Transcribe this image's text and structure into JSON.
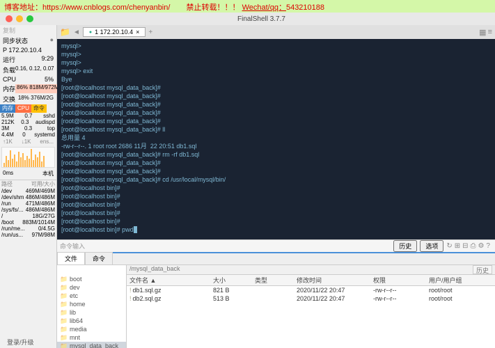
{
  "banner": {
    "prefix": "博客地址：",
    "url": "https://www.cnblogs.com/chenyanbin/",
    "warn": "禁止转载！！！",
    "contact_label": "Wechat/qq：",
    "contact": "543210188"
  },
  "titlebar": {
    "title": "FinalShell 3.7.7"
  },
  "sidebar": {
    "sync_label": "同步状态",
    "sync_icon": "●",
    "ip": "P 172.20.10.4",
    "runtime_label": "运行",
    "runtime": "9:29",
    "load_label": "负载",
    "load": "0.16, 0.12, 0.07",
    "cpu_label": "CPU",
    "cpu_pct": "5%",
    "mem_label": "内存",
    "mem_pct": "86%",
    "mem_detail": "818M/972M",
    "swap_label": "交换",
    "swap_pct": "18%",
    "swap_detail": "376M/2G",
    "tabs": {
      "mem": "内存",
      "cpu": "CPU",
      "cmd": "命令"
    },
    "procs": [
      {
        "mem": "5.9M",
        "cpu": "0.7",
        "name": "sshd"
      },
      {
        "mem": "212K",
        "cpu": "0.3",
        "name": "audispd"
      },
      {
        "mem": "3M",
        "cpu": "0.3",
        "name": "top"
      },
      {
        "mem": "4.4M",
        "cpu": "0",
        "name": "systemd"
      }
    ],
    "graph": {
      "l1": "↑1K",
      "l2": "↓1K",
      "l3": "ens..."
    },
    "graph_bars": [
      3,
      8,
      5,
      12,
      6,
      9,
      4,
      11,
      7,
      10,
      5,
      8,
      6,
      13,
      5,
      9,
      7,
      11,
      4,
      8
    ],
    "net_row": {
      "l": "0ms",
      "r": "本机"
    },
    "fs_header": {
      "c1": "路径",
      "c2": "可用/大小"
    },
    "fs": [
      {
        "p": "/dev",
        "s": "469M/469M"
      },
      {
        "p": "/dev/shm",
        "s": "486M/486M"
      },
      {
        "p": "/run",
        "s": "471M/486M"
      },
      {
        "p": "/sys/fs/...",
        "s": "486M/486M"
      },
      {
        "p": "/",
        "s": "18G/27G"
      },
      {
        "p": "/boot",
        "s": "883M/1014M"
      },
      {
        "p": "/run/me...",
        "s": "0/4.5G"
      },
      {
        "p": "/run/us...",
        "s": "97M/98M"
      }
    ],
    "footer": "登录/升级"
  },
  "tabbar": {
    "tab_label": "1 172.20.10.4",
    "tab_bullet": "●",
    "tab_plus": "+"
  },
  "terminal": {
    "lines": [
      "mysql>",
      "mysql>",
      "mysql>",
      "mysql> exit",
      "Bye",
      "[root@localhost mysql_data_back]#",
      "[root@localhost mysql_data_back]#",
      "[root@localhost mysql_data_back]#",
      "[root@localhost mysql_data_back]#",
      "[root@localhost mysql_data_back]#",
      "[root@localhost mysql_data_back]# ll",
      "总用量 4",
      "-rw-r--r--. 1 root root 2686 11月  22 20:51 db1.sql",
      "[root@localhost mysql_data_back]# rm -rf db1.sql",
      "[root@localhost mysql_data_back]#",
      "[root@localhost mysql_data_back]#",
      "[root@localhost mysql_data_back]# cd /usr/local/mysql/bin/",
      "[root@localhost bin]#",
      "[root@localhost bin]#",
      "[root@localhost bin]#",
      "[root@localhost bin]#",
      "[root@localhost bin]#",
      "[root@localhost bin]# pwd"
    ]
  },
  "cmdbar": {
    "placeholder": "命令输入",
    "history": "历史",
    "options": "选项"
  },
  "filetabs": {
    "files": "文件",
    "cmd": "命令"
  },
  "pathbar": {
    "path": "/mysql_data_back",
    "history": "历史"
  },
  "tree": [
    "boot",
    "dev",
    "etc",
    "home",
    "lib",
    "lib64",
    "media",
    "mnt",
    "mysql_data_back"
  ],
  "filelist": {
    "headers": {
      "name": "文件名 ▲",
      "size": "大小",
      "type": "类型",
      "date": "修改时间",
      "perm": "权限",
      "owner": "用户/用户组"
    },
    "rows": [
      {
        "name": "db1.sql.gz",
        "size": "821 B",
        "type": "",
        "date": "2020/11/22 20:47",
        "perm": "-rw-r--r--",
        "owner": "root/root"
      },
      {
        "name": "db2.sql.gz",
        "size": "513 B",
        "type": "",
        "date": "2020/11/22 20:47",
        "perm": "-rw-r--r--",
        "owner": "root/root"
      }
    ]
  }
}
